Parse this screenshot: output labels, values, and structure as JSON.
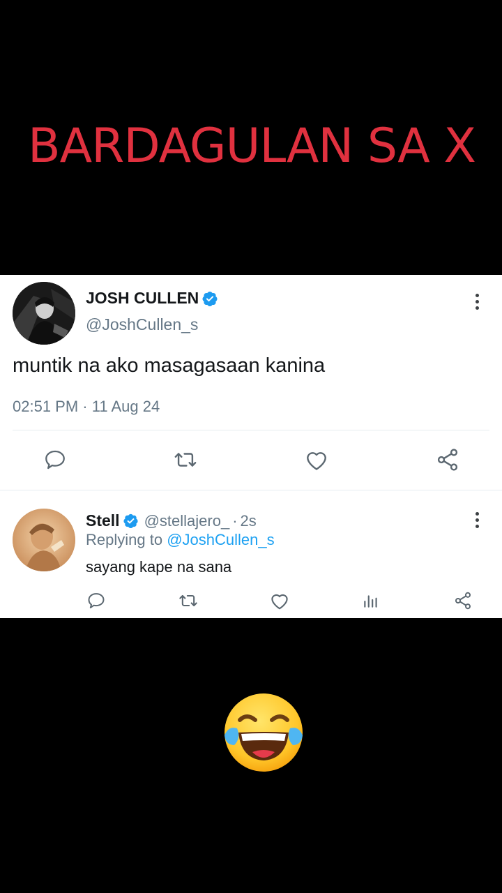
{
  "headline": "BARDAGULAN SA X",
  "main_tweet": {
    "author_name": "JOSH CULLEN",
    "author_handle": "@JoshCullen_s",
    "verified": true,
    "text": "muntik na ako masagasaan kanina",
    "timestamp": "02:51 PM · 11 Aug 24",
    "actions": [
      "reply-icon",
      "retweet-icon",
      "like-icon",
      "share-icon"
    ]
  },
  "reply_tweet": {
    "author_name": "Stell",
    "author_handle": "@stellajero_",
    "separator": "·",
    "time": "2s",
    "verified": true,
    "replying_prefix": "Replying to ",
    "replying_to": "@JoshCullen_s",
    "text": "sayang kape na sana",
    "actions": [
      "reply-icon",
      "retweet-icon",
      "like-icon",
      "analytics-icon",
      "share-icon"
    ]
  },
  "colors": {
    "headline": "#e0313f",
    "verified": "#1d9bf0",
    "mention": "#1da1f2",
    "secondary_text": "#657786",
    "icon": "#5b6770"
  },
  "reaction_emoji": "face-with-tears-of-joy-emoji"
}
